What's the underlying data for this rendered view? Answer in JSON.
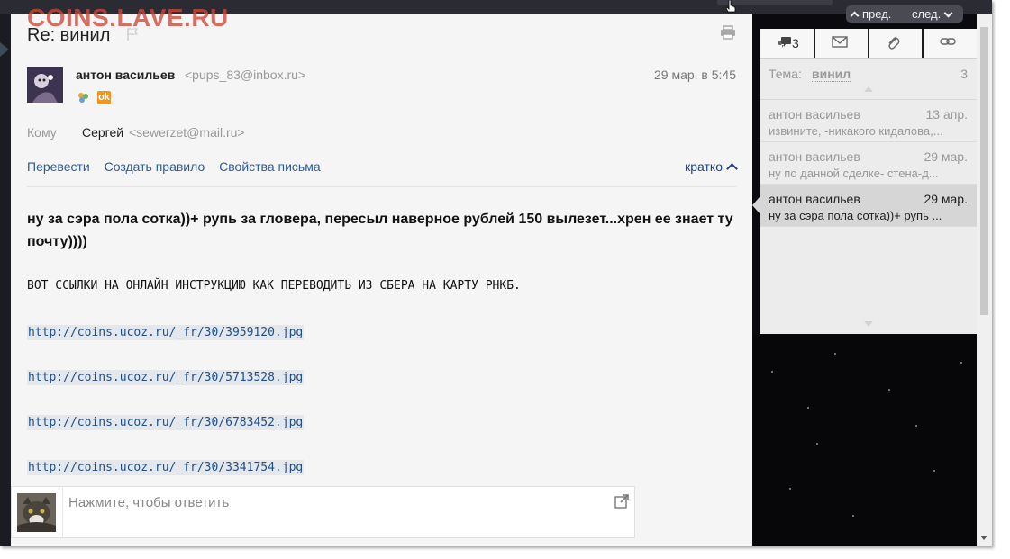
{
  "watermark": "COINS.LAVE.RU",
  "message": {
    "subject": "Re: винил",
    "sender_name": "антон васильев",
    "sender_email": "<pups_83@inbox.ru>",
    "date": "29 мар. в 5:45",
    "to_label": "Кому",
    "to_name": "Сергей",
    "to_email": "<sewerzet@mail.ru>",
    "actions": [
      "Перевести",
      "Создать правило",
      "Свойства письма"
    ],
    "short_label": "кратко",
    "body_line1": "ну за сэра пола сотка))+ рупь за гловера, пересыл наверное  рублей 150 вылезет...хрен ее знает ту почту))))",
    "caps_line": "ВОТ ССЫЛКИ НА ОНЛАЙН ИНСТРУКЦИЮ КАК ПЕРЕВОДИТЬ ИЗ СБЕРА НА КАРТУ РНКБ.",
    "links": [
      "http://coins.ucoz.ru/_fr/30/3959120.jpg",
      "http://coins.ucoz.ru/_fr/30/5713528.jpg",
      "http://coins.ucoz.ru/_fr/30/6783452.jpg",
      "http://coins.ucoz.ru/_fr/30/3341754.jpg"
    ],
    "social_badge": "ok"
  },
  "reply": {
    "placeholder": "Нажмите, чтобы ответить"
  },
  "nav": {
    "prev": "пред.",
    "next": "след."
  },
  "sidebar": {
    "tabs": [
      {
        "icon": "conversation-icon",
        "count": "3"
      },
      {
        "icon": "envelope-icon"
      },
      {
        "icon": "paperclip-icon"
      },
      {
        "icon": "link-icon"
      }
    ],
    "theme_label": "Тема:",
    "theme_value": "винил",
    "theme_count": "3",
    "threads": [
      {
        "name": "антон васильев",
        "date": "13 апр.",
        "snippet": "извините, -никакого кидалова,...",
        "active": false
      },
      {
        "name": "антон васильев",
        "date": "29 мар.",
        "snippet": "ну по данной сделке- стена-д...",
        "active": false
      },
      {
        "name": "антон васильев",
        "date": "29 мар.",
        "snippet": "ну за сэра пола сотка))+ рупь ...",
        "active": true
      }
    ]
  }
}
